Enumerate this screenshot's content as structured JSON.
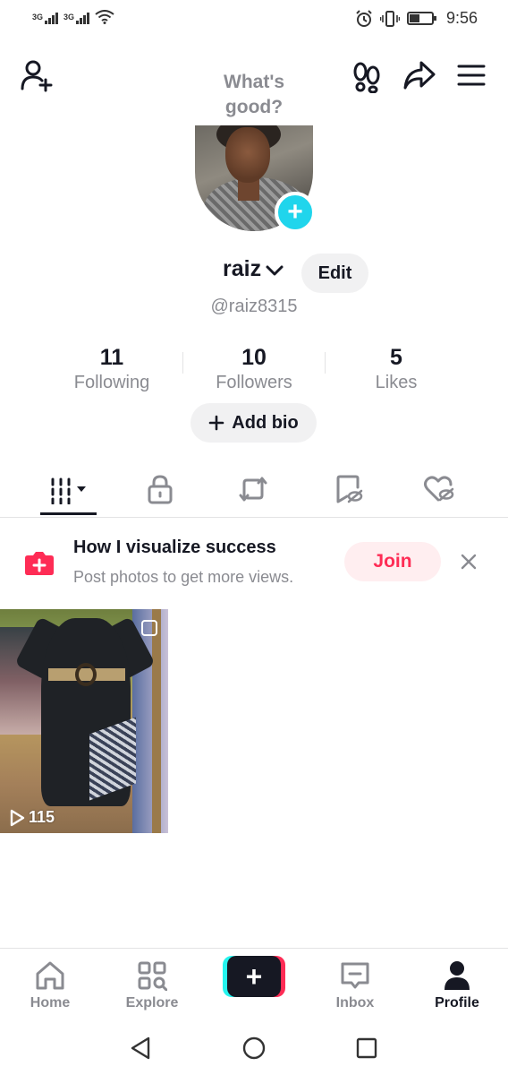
{
  "status_bar": {
    "network_1": "3G",
    "network_2": "3G",
    "time": "9:56"
  },
  "header": {
    "prompt": "What's good?"
  },
  "profile": {
    "name": "raiz",
    "edit_label": "Edit",
    "handle": "@raiz8315",
    "stats": [
      {
        "value": "11",
        "label": "Following"
      },
      {
        "value": "10",
        "label": "Followers"
      },
      {
        "value": "5",
        "label": "Likes"
      }
    ],
    "add_bio_label": "Add bio"
  },
  "tabs": [
    {
      "icon": "grid-videos-icon",
      "active": true
    },
    {
      "icon": "lock-icon",
      "active": false
    },
    {
      "icon": "repost-icon",
      "active": false
    },
    {
      "icon": "bookmark-hidden-icon",
      "active": false
    },
    {
      "icon": "liked-hidden-icon",
      "active": false
    }
  ],
  "promo": {
    "title": "How I visualize success",
    "subtitle": "Post photos to get more views.",
    "join_label": "Join"
  },
  "videos": [
    {
      "views": "115"
    }
  ],
  "bottom_nav": {
    "home": "Home",
    "explore": "Explore",
    "inbox": "Inbox",
    "profile": "Profile"
  },
  "colors": {
    "accent_red": "#fe2c55",
    "accent_cyan": "#20d5ec",
    "text_primary": "#161823",
    "text_secondary": "#8a8b91"
  }
}
